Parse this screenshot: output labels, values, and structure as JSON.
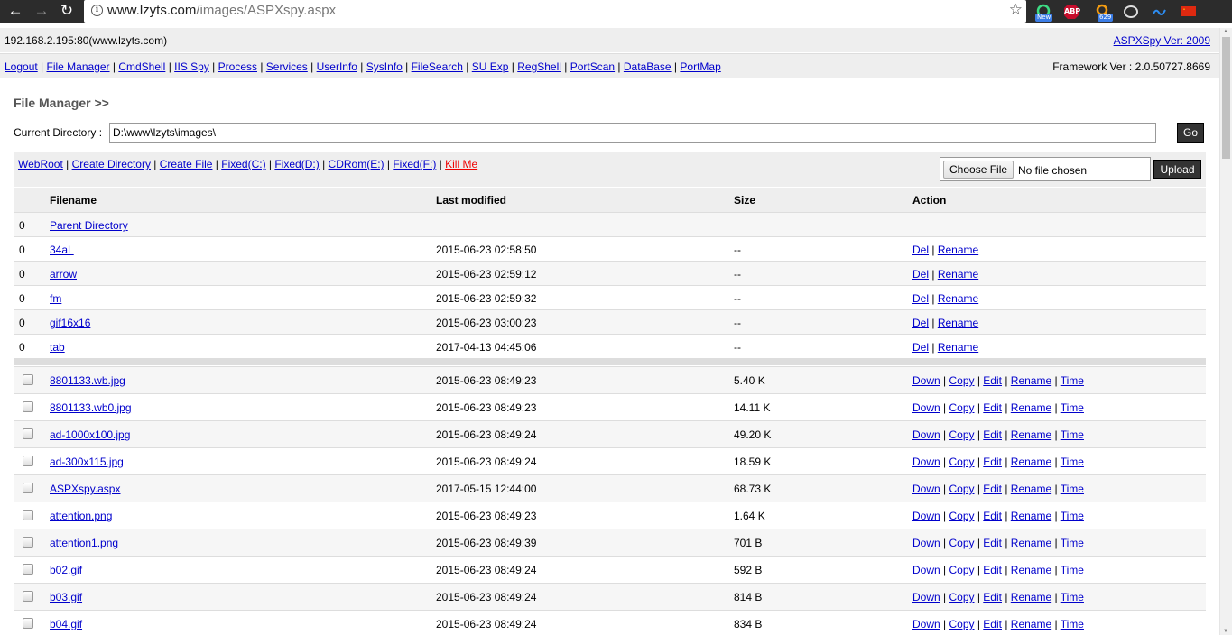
{
  "browser": {
    "url_host": "www.lzyts.com",
    "url_path": "/images/ASPXspy.aspx",
    "ext_badges": [
      "New",
      "ABP",
      "629"
    ]
  },
  "header": {
    "server": "192.168.2.195:80(www.lzyts.com)",
    "version": "ASPXSpy Ver: 2009",
    "framework": "Framework Ver : 2.0.50727.8669"
  },
  "menu": [
    "Logout",
    "File Manager",
    "CmdShell",
    "IIS Spy",
    "Process",
    "Services",
    "UserInfo",
    "SysInfo",
    "FileSearch",
    "SU Exp",
    "RegShell",
    "PortScan",
    "DataBase",
    "PortMap"
  ],
  "page_title": "File Manager >>",
  "current_dir": {
    "label": "Current Directory :",
    "value": "D:\\www\\lzyts\\images\\",
    "go": "Go"
  },
  "toolbar": {
    "links": [
      "WebRoot",
      "Create Directory",
      "Create File",
      "Fixed(C:)",
      "Fixed(D:)",
      "CDRom(E:)",
      "Fixed(F:)"
    ],
    "kill": "Kill Me",
    "choose_file": "Choose File",
    "no_file": "No file chosen",
    "upload": "Upload"
  },
  "table": {
    "headers": [
      "Filename",
      "Last modified",
      "Size",
      "Action"
    ],
    "parent": {
      "num": "0",
      "name": "Parent Directory"
    },
    "dirs": [
      {
        "num": "0",
        "name": "34aL",
        "modified": "2015-06-23 02:58:50",
        "size": "--"
      },
      {
        "num": "0",
        "name": "arrow",
        "modified": "2015-06-23 02:59:12",
        "size": "--"
      },
      {
        "num": "0",
        "name": "fm",
        "modified": "2015-06-23 02:59:32",
        "size": "--"
      },
      {
        "num": "0",
        "name": "gif16x16",
        "modified": "2015-06-23 03:00:23",
        "size": "--"
      },
      {
        "num": "0",
        "name": "tab",
        "modified": "2017-04-13 04:45:06",
        "size": "--"
      }
    ],
    "dir_actions": [
      "Del",
      "Rename"
    ],
    "files": [
      {
        "name": "8801133.wb.jpg",
        "modified": "2015-06-23 08:49:23",
        "size": "5.40 K"
      },
      {
        "name": "8801133.wb0.jpg",
        "modified": "2015-06-23 08:49:23",
        "size": "14.11 K"
      },
      {
        "name": "ad-1000x100.jpg",
        "modified": "2015-06-23 08:49:24",
        "size": "49.20 K"
      },
      {
        "name": "ad-300x115.jpg",
        "modified": "2015-06-23 08:49:24",
        "size": "18.59 K"
      },
      {
        "name": "ASPXspy.aspx",
        "modified": "2017-05-15 12:44:00",
        "size": "68.73 K"
      },
      {
        "name": "attention.png",
        "modified": "2015-06-23 08:49:23",
        "size": "1.64 K"
      },
      {
        "name": "attention1.png",
        "modified": "2015-06-23 08:49:39",
        "size": "701 B"
      },
      {
        "name": "b02.gif",
        "modified": "2015-06-23 08:49:24",
        "size": "592 B"
      },
      {
        "name": "b03.gif",
        "modified": "2015-06-23 08:49:24",
        "size": "814 B"
      },
      {
        "name": "b04.gif",
        "modified": "2015-06-23 08:49:24",
        "size": "834 B"
      }
    ],
    "file_actions": [
      "Down",
      "Copy",
      "Edit",
      "Rename",
      "Time"
    ]
  }
}
